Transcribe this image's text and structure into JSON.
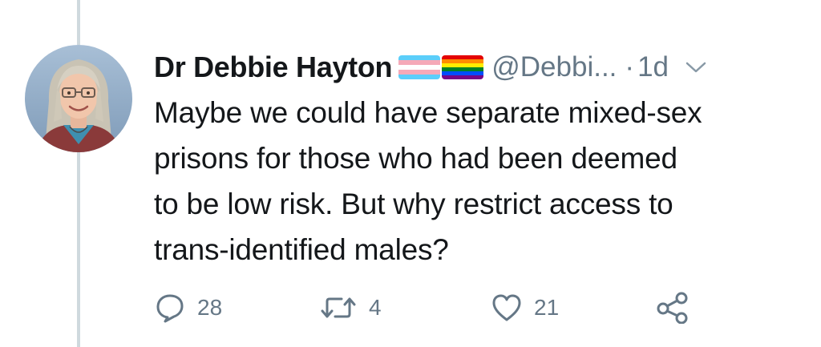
{
  "tweet": {
    "author": {
      "display_name": "Dr Debbie Hayton",
      "handle": "@Debbi...",
      "badges": [
        "transgender-flag-emoji",
        "rainbow-flag-emoji"
      ]
    },
    "separator": "·",
    "time": "1d",
    "text_lines": [
      "Maybe we could have separate mixed-sex",
      "prisons for those who had been deemed",
      "to be low risk. But why restrict access to",
      "trans-identified males?"
    ],
    "actions": {
      "reply_count": "28",
      "retweet_count": "4",
      "like_count": "21"
    }
  },
  "colors": {
    "text": "#14171a",
    "muted": "#657786",
    "thread_line": "#cfd9de"
  }
}
